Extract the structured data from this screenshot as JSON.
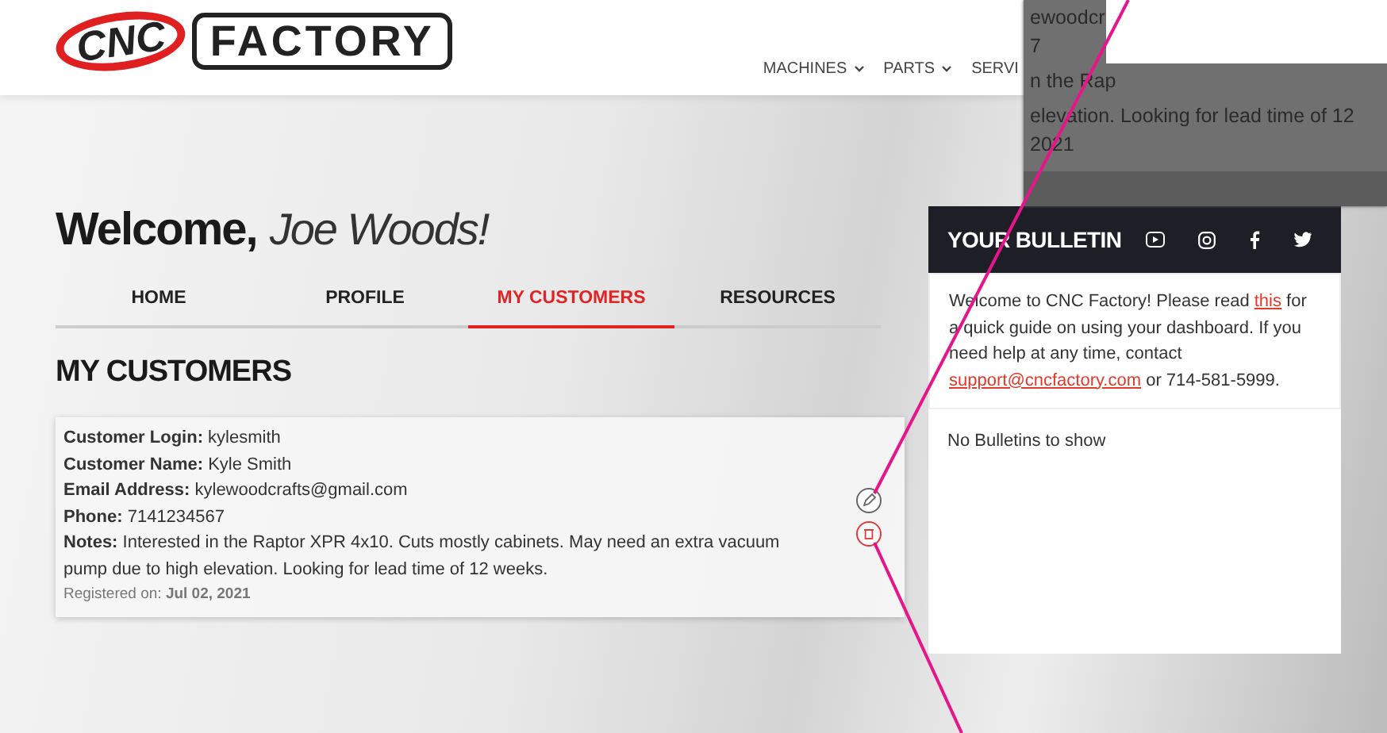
{
  "header": {
    "logo": {
      "mark": "CNC",
      "word": "FACTORY"
    },
    "nav": [
      {
        "label": "MACHINES",
        "dropdown": true
      },
      {
        "label": "PARTS",
        "dropdown": true
      },
      {
        "label": "SERVI",
        "dropdown": false
      }
    ]
  },
  "welcome": {
    "greeting": "Welcome,",
    "name": "Joe Woods!"
  },
  "tabs": [
    {
      "label": "HOME",
      "selected": false
    },
    {
      "label": "PROFILE",
      "selected": false
    },
    {
      "label": "MY CUSTOMERS",
      "selected": true
    },
    {
      "label": "RESOURCES",
      "selected": false
    }
  ],
  "section_title": "MY CUSTOMERS",
  "customers": [
    {
      "fields": [
        {
          "label": "Customer Login:",
          "value": "kylesmith"
        },
        {
          "label": "Customer Name:",
          "value": "Kyle Smith"
        },
        {
          "label": "Email Address:",
          "value": "kylewoodcrafts@gmail.com"
        },
        {
          "label": "Phone:",
          "value": "7141234567"
        },
        {
          "label": "Notes:",
          "value": "Interested in the Raptor XPR 4x10. Cuts mostly cabinets. May need an extra vacuum pump due to high elevation. Looking for lead time of 12 weeks."
        }
      ],
      "registered_label": "Registered on:",
      "registered_date": "Jul 02, 2021"
    }
  ],
  "bulletin": {
    "title": "YOUR BULLETIN",
    "message": [
      {
        "kind": "text",
        "text": "Welcome to CNC Factory! Please read "
      },
      {
        "kind": "link",
        "text": "this"
      },
      {
        "kind": "text",
        "text": " for a quick guide on using your dashboard. If you need help at any time, contact "
      },
      {
        "kind": "link",
        "text": "support@cncfactory.com"
      },
      {
        "kind": "text",
        "text": " or 714-581-5999."
      }
    ],
    "empty": "No Bulletins to show"
  },
  "magnifier": {
    "lines": [
      "ewoodcr",
      "7",
      "n the Rap",
      "elevation. Looking for lead time of 12",
      "2021"
    ]
  }
}
